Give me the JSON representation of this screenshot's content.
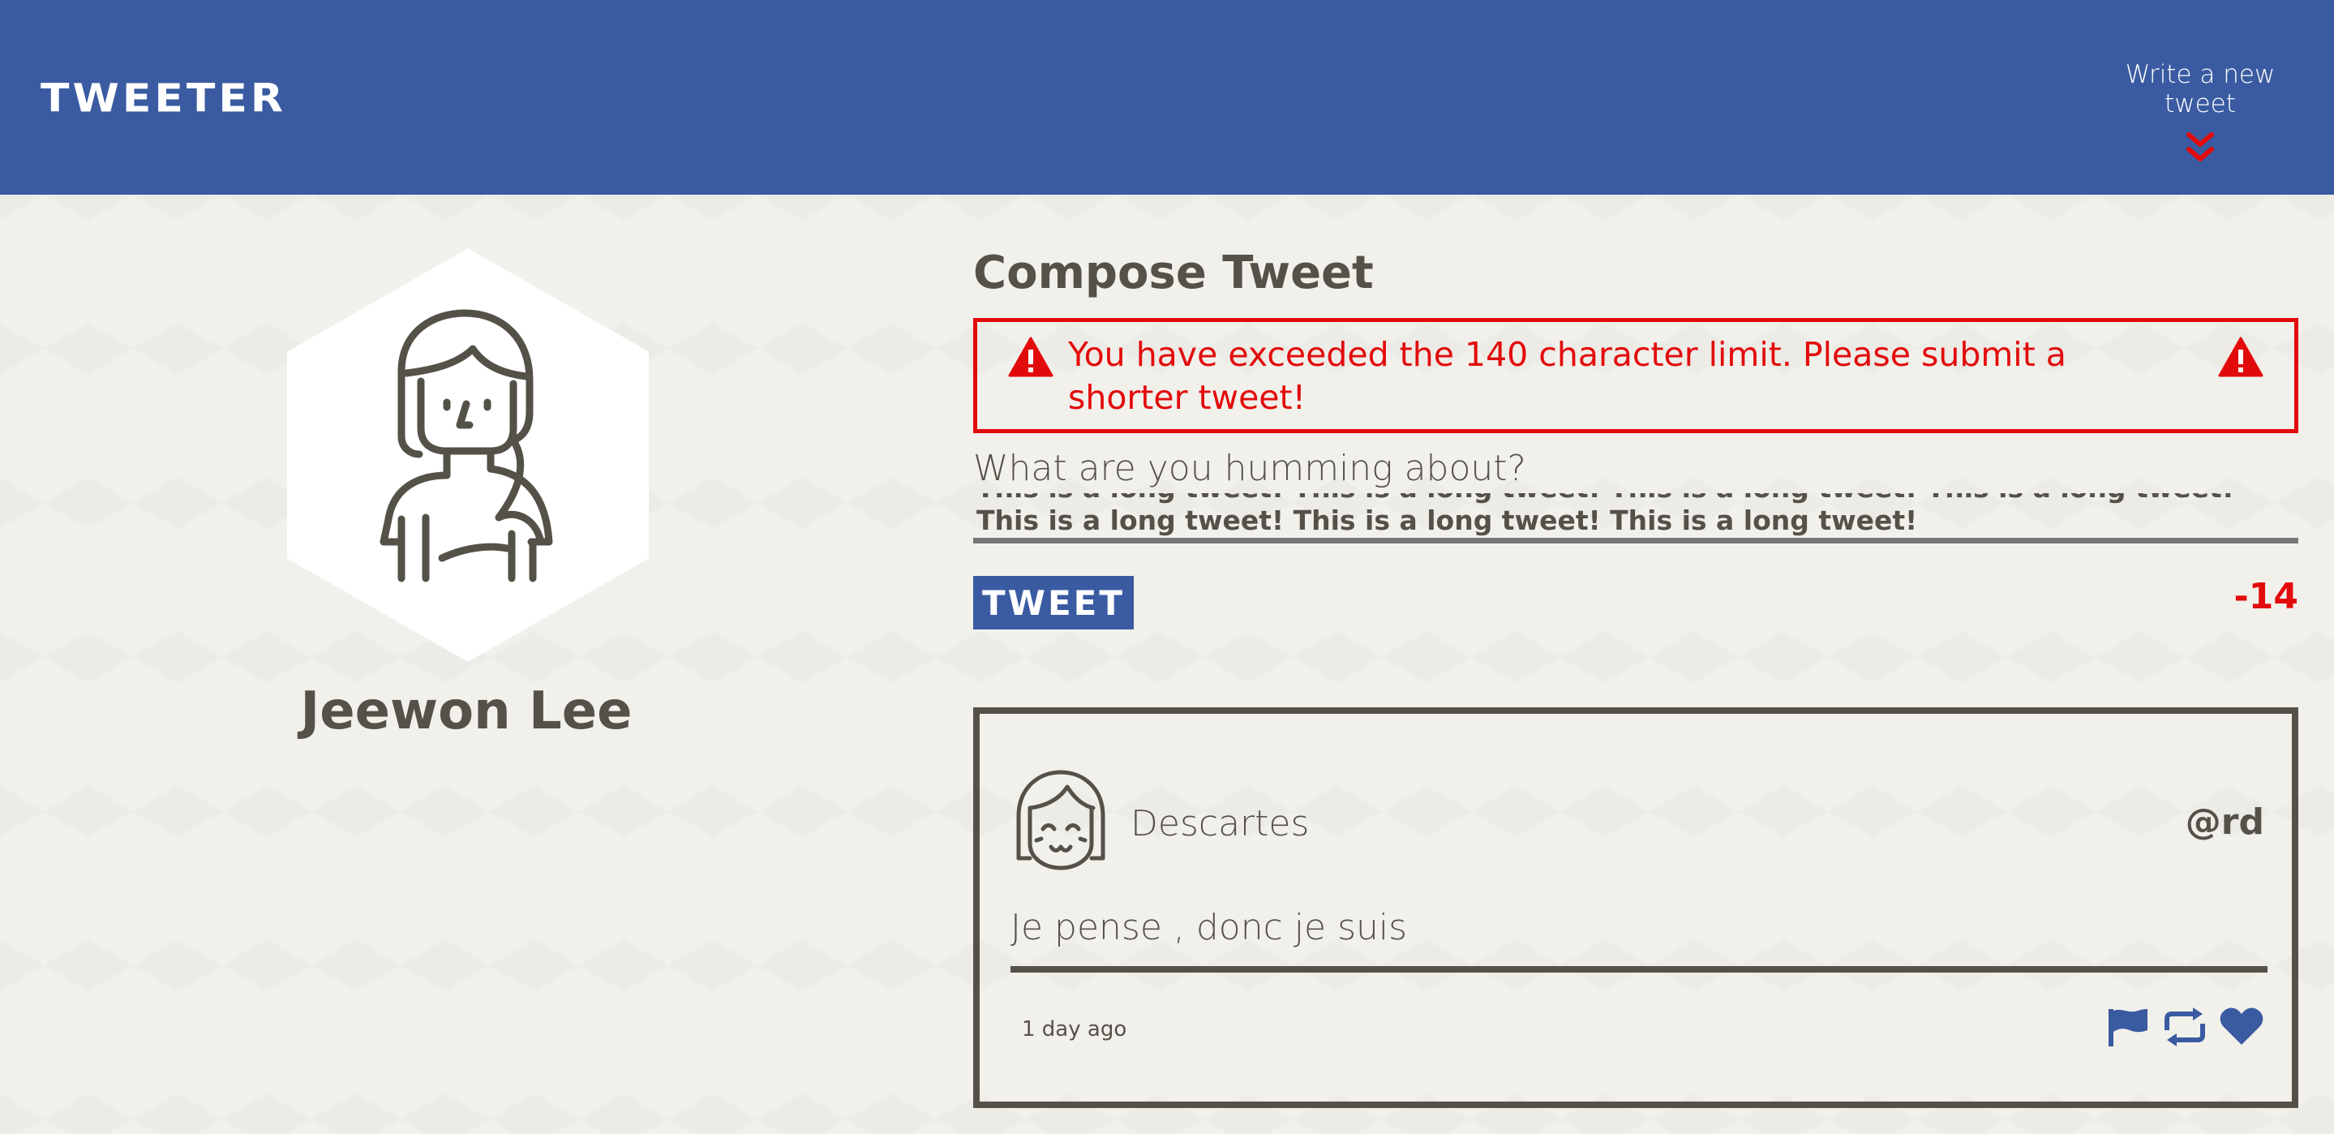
{
  "nav": {
    "brand": "TWEETER",
    "compose_toggle_label": "Write a new tweet",
    "compose_toggle_icon": "double-chevron-down-icon"
  },
  "profile": {
    "name": "Jeewon Lee",
    "avatar_icon": "user-avatar-icon"
  },
  "compose": {
    "title": "Compose Tweet",
    "error_message": "You have exceeded the 140 character limit. Please submit a shorter tweet!",
    "error_icon": "warning-triangle-icon",
    "prompt": "What are you humming about?",
    "textarea_value": "This is a long tweet! This is a long tweet! This is a long tweet! This is a long tweet! This is a long tweet! This is a long tweet! This is a long tweet!",
    "submit_label": "TWEET",
    "counter": "-14"
  },
  "tweets": [
    {
      "author_name": "Descartes",
      "handle": "@rd",
      "content": "Je pense , donc je suis",
      "time": "1 day ago",
      "actions": [
        "flag-icon",
        "retweet-icon",
        "heart-icon"
      ]
    }
  ],
  "colors": {
    "nav_bg": "#3a5ba1",
    "page_bg": "#f2f0eb",
    "text": "#545149",
    "error": "#e20b0b",
    "accent": "#3a5ba1"
  }
}
